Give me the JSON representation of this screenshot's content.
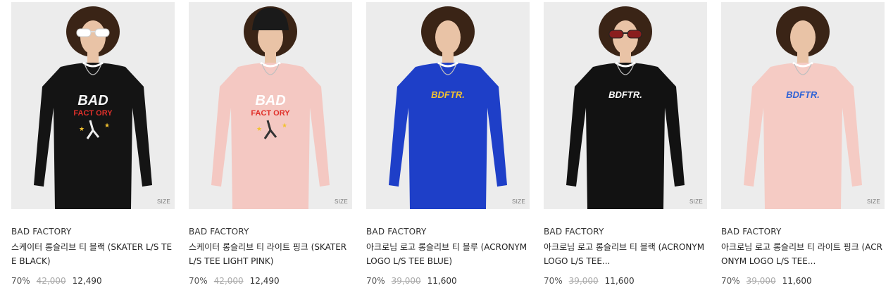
{
  "products": [
    {
      "size_label": "SIZE",
      "brand": "BAD FACTORY",
      "title": "스케이터 롱슬리브 티 블랙 (SKATER L/S TEE BLACK)",
      "discount": "70%",
      "original_price": "42,000",
      "sale_price": "12,490",
      "shirt_color": "#141414",
      "accessory": "sunglasses-white",
      "print": [
        "BAD",
        "FACT ORY"
      ],
      "print_color": "#f4f4f4"
    },
    {
      "size_label": "SIZE",
      "brand": "BAD FACTORY",
      "title": "스케이터 롱슬리브 티 라이트 핑크 (SKATER L/S TEE LIGHT PINK)",
      "discount": "70%",
      "original_price": "42,000",
      "sale_price": "12,490",
      "shirt_color": "#f4c8c2",
      "accessory": "beanie-black",
      "print": [
        "BAD",
        "FACT ORY"
      ],
      "print_color": "#ffffff"
    },
    {
      "size_label": "SIZE",
      "brand": "BAD FACTORY",
      "title": "아크로님 로고 롱슬리브 티 블루 (ACRONYM LOGO L/S TEE BLUE)",
      "discount": "70%",
      "original_price": "39,000",
      "sale_price": "11,600",
      "shirt_color": "#1e3fc8",
      "accessory": "none",
      "print": [
        "BDFTR."
      ],
      "print_color": "#f2c230"
    },
    {
      "size_label": "SIZE",
      "brand": "BAD FACTORY",
      "title": "아크로님 로고 롱슬리브 티 블랙 (ACRONYM LOGO L/S TEE...",
      "discount": "70%",
      "original_price": "39,000",
      "sale_price": "11,600",
      "shirt_color": "#121212",
      "accessory": "sunglasses-red",
      "print": [
        "BDFTR."
      ],
      "print_color": "#ffffff"
    },
    {
      "size_label": "SIZE",
      "brand": "BAD FACTORY",
      "title": "아크로님 로고 롱슬리브 티 라이트 핑크 (ACRONYM LOGO L/S TEE...",
      "discount": "70%",
      "original_price": "39,000",
      "sale_price": "11,600",
      "shirt_color": "#f5cbc4",
      "accessory": "none",
      "print": [
        "BDFTR."
      ],
      "print_color": "#2f63d6"
    }
  ]
}
